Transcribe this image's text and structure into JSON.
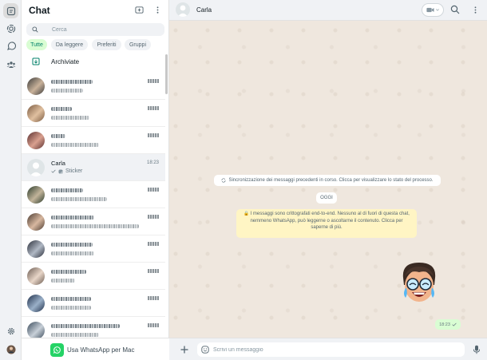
{
  "panel": {
    "title": "Chat",
    "search_placeholder": "Cerca",
    "filters": [
      "Tutte",
      "Da leggere",
      "Preferiti",
      "Gruppi"
    ],
    "archived_label": "Archiviate"
  },
  "chats": [
    {
      "name": "",
      "time": "",
      "preview": "",
      "blurred": true
    },
    {
      "name": "",
      "time": "",
      "preview": "",
      "blurred": true
    },
    {
      "name": "",
      "time": "",
      "preview": "",
      "blurred": true
    },
    {
      "name": "Carla",
      "time": "18:23",
      "preview": "Sticker",
      "blurred": false,
      "selected": true
    },
    {
      "name": "",
      "time": "",
      "preview": "",
      "blurred": true
    },
    {
      "name": "",
      "time": "",
      "preview": "",
      "blurred": true
    },
    {
      "name": "",
      "time": "",
      "preview": "",
      "blurred": true
    },
    {
      "name": "",
      "time": "",
      "preview": "",
      "blurred": true
    },
    {
      "name": "",
      "time": "",
      "preview": "",
      "blurred": true
    },
    {
      "name": "",
      "time": "",
      "preview": "",
      "blurred": true
    }
  ],
  "mac_banner": "Usa WhatsApp per Mac",
  "conversation": {
    "contact_name": "Carla",
    "sync_notice": "Sincronizzazione dei messaggi precedenti in corso. Clicca per visualizzare lo stato del processo.",
    "date_label": "OGGI",
    "encryption_notice": "I messaggi sono crittografati end-to-end. Nessuno al di fuori di questa chat, nemmeno WhatsApp, può leggerne o ascoltarne il contenuto. Clicca per saperne di più.",
    "message_time": "18:23",
    "compose_placeholder": "Scrivi un messaggio"
  },
  "colors": {
    "accent": "#008069",
    "brand": "#25d366",
    "wallpaper": "#efe7de",
    "sent_bubble": "#d9fdd3",
    "notice_yellow": "#fff5c4"
  }
}
